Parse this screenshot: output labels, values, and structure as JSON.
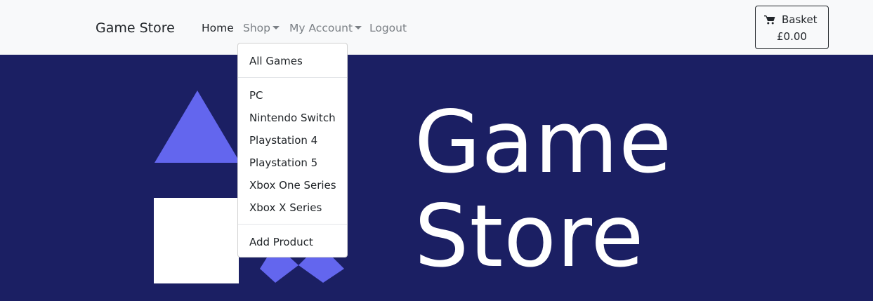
{
  "navbar": {
    "brand": "Game Store",
    "links": {
      "home": "Home",
      "shop": "Shop",
      "account": "My Account",
      "logout": "Logout"
    },
    "basket": {
      "label": "Basket",
      "total": "£0.00",
      "icon": "cart-icon"
    }
  },
  "shop_menu": {
    "all_games": "All Games",
    "platforms": [
      "PC",
      "Nintendo Switch",
      "Playstation 4",
      "Playstation 5",
      "Xbox One Series",
      "Xbox X Series"
    ],
    "add_product": "Add Product"
  },
  "hero": {
    "title_line1": "Game",
    "title_line2": "Store",
    "colors": {
      "background": "#1b1f63",
      "accent": "#6366ee",
      "white": "#ffffff"
    }
  }
}
